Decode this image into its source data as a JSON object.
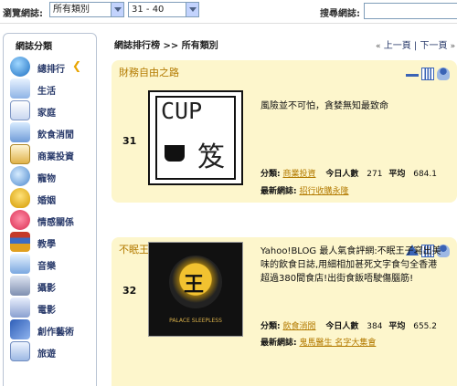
{
  "topbar": {
    "browse_label": "瀏覽網誌:",
    "category_value": "所有類別",
    "range_value": "31 - 40",
    "search_label": "搜尋網誌:"
  },
  "sidebar": {
    "title": "網誌分類",
    "items": [
      {
        "label": "總排行",
        "icon": "globe-icon"
      },
      {
        "label": "生活",
        "icon": "life-icon"
      },
      {
        "label": "家庭",
        "icon": "family-icon"
      },
      {
        "label": "飲食消閒",
        "icon": "dining-icon"
      },
      {
        "label": "商業投資",
        "icon": "business-icon"
      },
      {
        "label": "寵物",
        "icon": "pet-icon"
      },
      {
        "label": "婚姻",
        "icon": "marriage-icon"
      },
      {
        "label": "情感關係",
        "icon": "heart-icon"
      },
      {
        "label": "教學",
        "icon": "books-icon"
      },
      {
        "label": "音樂",
        "icon": "music-icon"
      },
      {
        "label": "攝影",
        "icon": "camera-icon"
      },
      {
        "label": "電影",
        "icon": "film-icon"
      },
      {
        "label": "創作藝術",
        "icon": "art-icon"
      },
      {
        "label": "旅遊",
        "icon": "travel-icon"
      }
    ]
  },
  "main": {
    "breadcrumb": "網誌排行榜 >> 所有類別",
    "prev_label": "上一頁",
    "separator": "|",
    "next_label": "下一頁"
  },
  "cards": [
    {
      "title": "財務自由之路",
      "rank": "31",
      "thumb_text": "CUP",
      "thumb_char": "笈",
      "description": "風險並不可怕，貪婪無知最致命",
      "category_label": "分類:",
      "category_value": "商業投資",
      "visitors_label": "今日人數",
      "visitors_value": "271",
      "average_label": "平均",
      "average_value": "684.1",
      "latest_label": "最新網誌:",
      "latest_value": "招行收購永隆"
    },
    {
      "title": "不眠王宮",
      "rank": "32",
      "thumb_text": "PALACE SLEEPLESS",
      "thumb_char": "王",
      "description": "Yahoo!BLOG 最人氣食評網:不眠王子寫出美味的飲食日誌,用細相加甚死文字食勻全香港超過380間食店!出街食飯唔駛傷腦筋!",
      "category_label": "分類:",
      "category_value": "飲食消閒",
      "visitors_label": "今日人數",
      "visitors_value": "384",
      "average_label": "平均",
      "average_value": "655.2",
      "latest_label": "最新網誌:",
      "latest_value": "鬼馬醫生 名字大集會"
    }
  ],
  "colors": {
    "card_bg": "#fdf6cc",
    "card_title": "#b37a00",
    "link": "#b37a00",
    "sidebar_text": "#2a3b6b"
  }
}
